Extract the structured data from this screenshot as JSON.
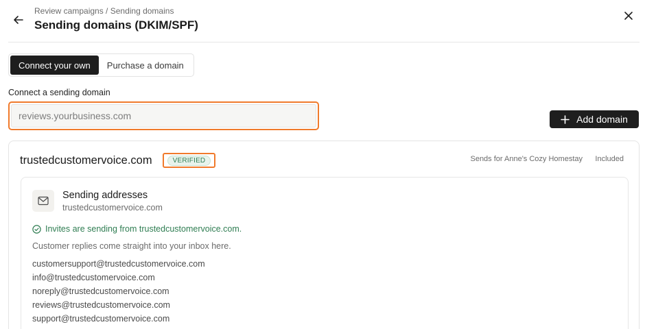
{
  "header": {
    "breadcrumb": "Review campaigns / Sending domains",
    "title": "Sending domains (DKIM/SPF)",
    "back_icon": "arrow-left-icon",
    "close_icon": "close-icon"
  },
  "tabs": [
    {
      "label": "Connect your own",
      "active": true
    },
    {
      "label": "Purchase a domain",
      "active": false
    }
  ],
  "form": {
    "label": "Connect a sending domain",
    "input_value": "",
    "placeholder": "reviews.yourbusiness.com",
    "add_button_label": "Add domain",
    "add_icon": "plus-icon"
  },
  "domain": {
    "name": "trustedcustomervoice.com",
    "badge": "VERIFIED",
    "sends_for": "Sends for Anne's Cozy Homestay",
    "plan": "Included",
    "sending": {
      "title": "Sending addresses",
      "subtitle": "trustedcustomervoice.com",
      "icon": "mail-icon",
      "status_icon": "check-circle-icon",
      "status": "Invites are sending from trustedcustomervoice.com.",
      "info": "Customer replies come straight into your inbox here.",
      "addresses": [
        "customersupport@trustedcustomervoice.com",
        "info@trustedcustomervoice.com",
        "noreply@trustedcustomervoice.com",
        "reviews@trustedcustomervoice.com",
        "support@trustedcustomervoice.com"
      ]
    }
  },
  "colors": {
    "accent_highlight": "#f07a2b",
    "primary_button": "#1e1e1e",
    "success": "#2f7d52"
  }
}
